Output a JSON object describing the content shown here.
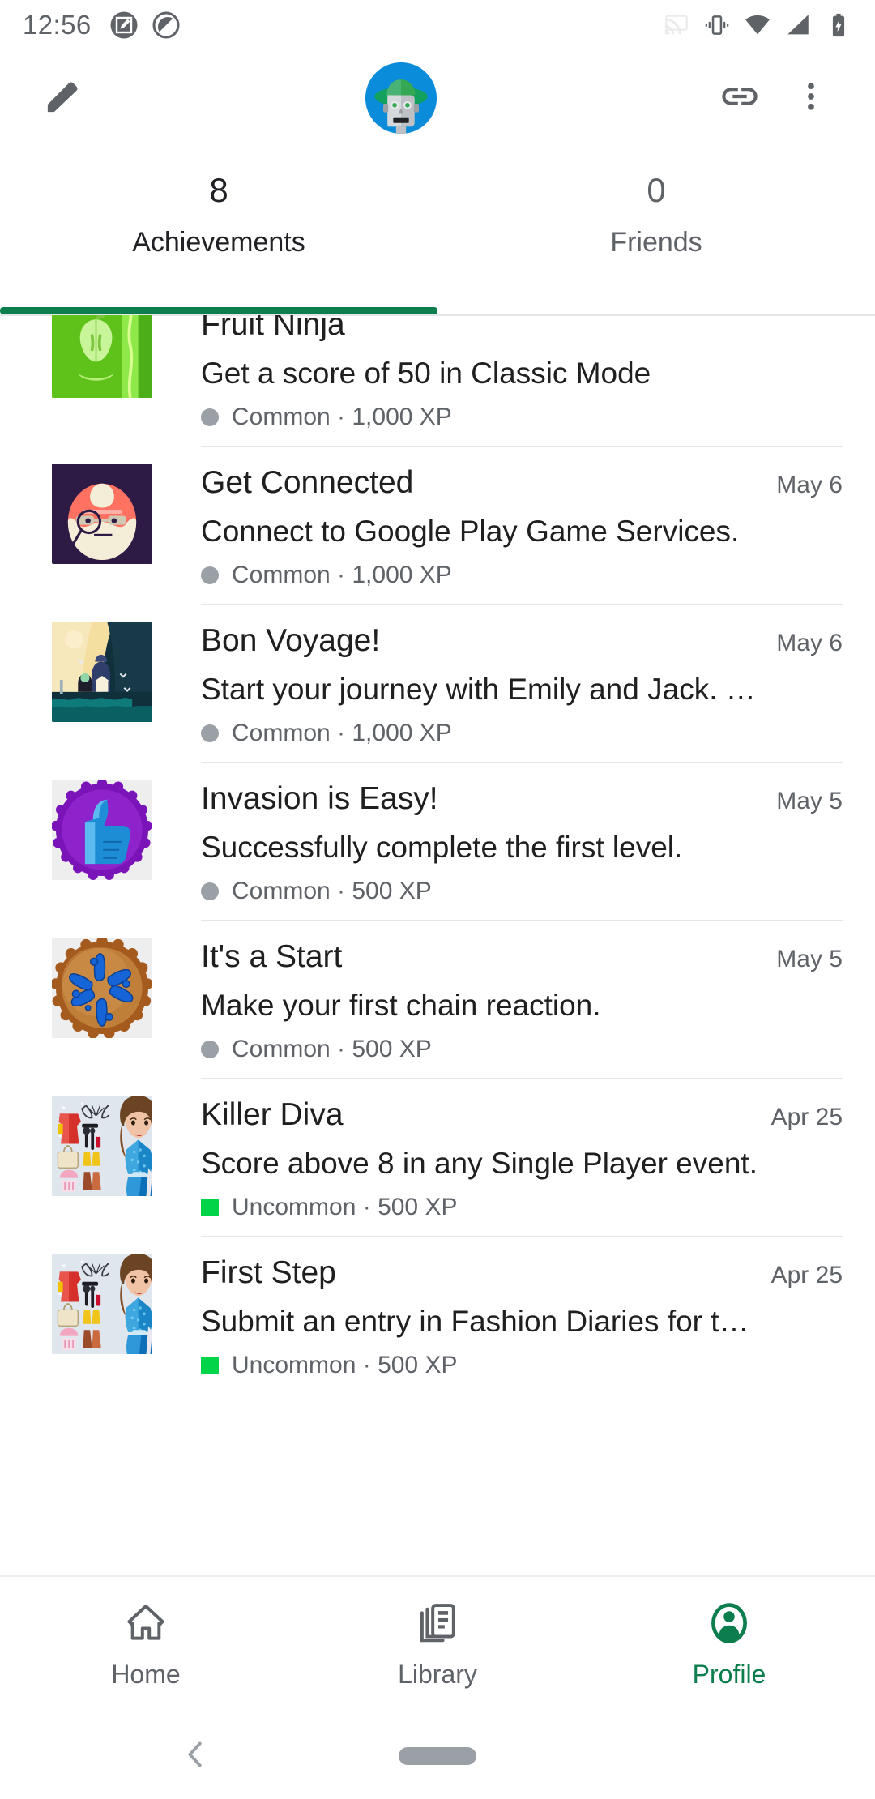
{
  "status_bar": {
    "time": "12:56",
    "left_icons": [
      "screenshot-edit-icon",
      "dnd-icon"
    ],
    "right_icons": [
      "cast-icon",
      "vibrate-icon",
      "wifi-icon",
      "signal-icon",
      "battery-charging-icon"
    ]
  },
  "app_bar": {
    "edit_label": "pencil-icon",
    "avatar_label": "robot-avatar",
    "link_label": "link-icon",
    "more_label": "more-vert-icon"
  },
  "tabs": [
    {
      "count": "8",
      "label": "Achievements",
      "active": true
    },
    {
      "count": "0",
      "label": "Friends",
      "active": false
    }
  ],
  "achievements": [
    {
      "title": "Fruit Ninja",
      "date": "",
      "description": "Get a score of 50 in Classic Mode",
      "rarity": "Common",
      "xp": "1,000 XP",
      "rarity_type": "common",
      "icon": "apple-slice"
    },
    {
      "title": "Get Connected",
      "date": "May 6",
      "description": "Connect to Google Play Game Services.",
      "rarity": "Common",
      "xp": "1,000 XP",
      "rarity_type": "common",
      "icon": "detective"
    },
    {
      "title": "Bon Voyage!",
      "date": "May 6",
      "description": "Start your journey with Emily and Jack. …",
      "rarity": "Common",
      "xp": "1,000 XP",
      "rarity_type": "common",
      "icon": "seaside"
    },
    {
      "title": "Invasion is Easy!",
      "date": "May 5",
      "description": "Successfully complete the first level.",
      "rarity": "Common",
      "xp": "500 XP",
      "rarity_type": "common",
      "icon": "purple-thumbsup"
    },
    {
      "title": "It's a Start",
      "date": "May 5",
      "description": "Make your first chain reaction.",
      "rarity": "Common",
      "xp": "500 XP",
      "rarity_type": "common",
      "icon": "bronze-burst"
    },
    {
      "title": "Killer Diva",
      "date": "Apr 25",
      "description": "Score above 8 in any Single Player event.",
      "rarity": "Uncommon",
      "xp": "500 XP",
      "rarity_type": "uncommon",
      "icon": "fashion-diva"
    },
    {
      "title": "First Step",
      "date": "Apr 25",
      "description": "Submit an entry in Fashion Diaries for t…",
      "rarity": "Uncommon",
      "xp": "500 XP",
      "rarity_type": "uncommon",
      "icon": "fashion-diva"
    }
  ],
  "bottom_nav": [
    {
      "label": "Home",
      "icon": "home-icon",
      "active": false
    },
    {
      "label": "Library",
      "icon": "library-icon",
      "active": false
    },
    {
      "label": "Profile",
      "icon": "profile-icon",
      "active": true
    }
  ],
  "gesture_bar": {
    "back": "back-chevron-icon",
    "pill": "home-pill"
  },
  "colors": {
    "accent": "#0c7d4d",
    "common": "#9aa0a6",
    "uncommon": "#00d449",
    "text_primary": "#1f1f1f",
    "text_secondary": "#5f6368"
  }
}
